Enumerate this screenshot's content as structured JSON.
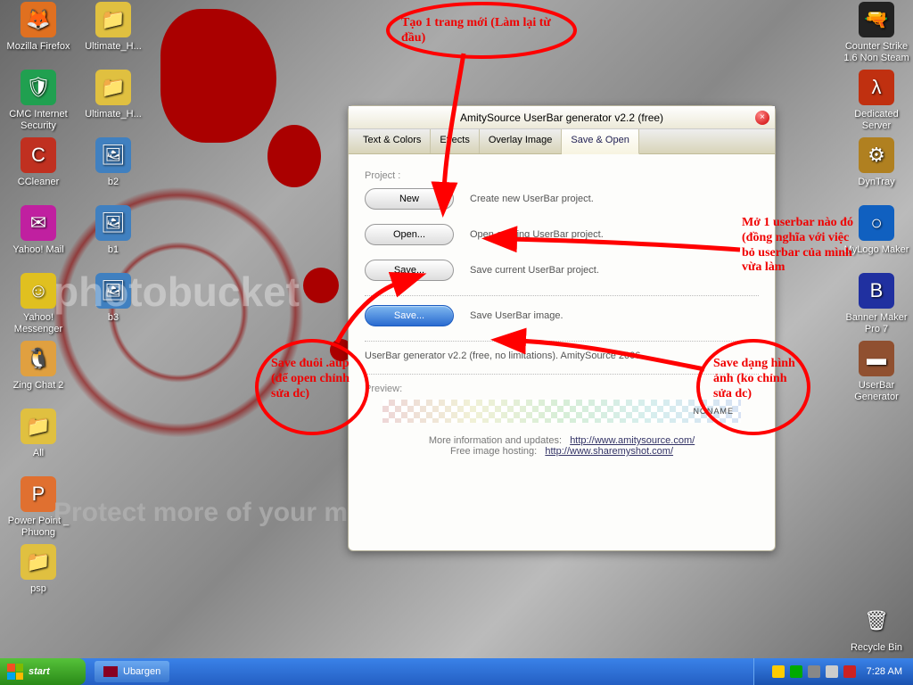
{
  "desktop": {
    "icons_left": [
      {
        "label": "Mozilla Firefox",
        "bg": "#e07020",
        "glyph": "🦊"
      },
      {
        "label": "CMC Internet Security",
        "bg": "#20a050",
        "glyph": "🛡"
      },
      {
        "label": "CCleaner",
        "bg": "#c03020",
        "glyph": "C"
      },
      {
        "label": "Yahoo! Mail",
        "bg": "#c020a0",
        "glyph": "✉"
      },
      {
        "label": "Yahoo! Messenger",
        "bg": "#e0c020",
        "glyph": "☺"
      },
      {
        "label": "Zing Chat 2",
        "bg": "#e0a040",
        "glyph": "🐧"
      },
      {
        "label": "All",
        "bg": "#e0c040",
        "glyph": "📁"
      },
      {
        "label": "Power Point _ Phuong",
        "bg": "#e07030",
        "glyph": "P"
      },
      {
        "label": "psp",
        "bg": "#e0c040",
        "glyph": "📁"
      }
    ],
    "icons_left2": [
      {
        "label": "Ultimate_H...",
        "bg": "#e0c040",
        "glyph": "📁"
      },
      {
        "label": "Ultimate_H...",
        "bg": "#e0c040",
        "glyph": "📁"
      },
      {
        "label": "b2",
        "bg": "#4080c0",
        "glyph": "🖼"
      },
      {
        "label": "b1",
        "bg": "#4080c0",
        "glyph": "🖼"
      },
      {
        "label": "b3",
        "bg": "#4080c0",
        "glyph": "🖼"
      }
    ],
    "icons_right": [
      {
        "label": "Counter Strike 1.6 Non Steam",
        "bg": "#222",
        "glyph": "🔫"
      },
      {
        "label": "Dedicated Server",
        "bg": "#c03010",
        "glyph": "λ"
      },
      {
        "label": "DynTray",
        "bg": "#b08020",
        "glyph": "⚙"
      },
      {
        "label": "MyLogo Maker",
        "bg": "#1060c0",
        "glyph": "○"
      },
      {
        "label": "Banner Maker Pro 7",
        "bg": "#2030a0",
        "glyph": "B"
      },
      {
        "label": "UserBar Generator",
        "bg": "#905030",
        "glyph": "▬"
      },
      {
        "label": "Recycle Bin",
        "bg": "transparent",
        "glyph": "🗑"
      }
    ]
  },
  "app": {
    "title": "AmitySource UserBar generator v2.2 (free)",
    "tabs": [
      "Text & Colors",
      "Effects",
      "Overlay Image",
      "Save & Open"
    ],
    "activeTab": 3,
    "project_label": "Project :",
    "btn_new": "New",
    "btn_new_desc": "Create new UserBar project.",
    "btn_open": "Open...",
    "btn_open_desc": "Open existing UserBar project.",
    "btn_save": "Save...",
    "btn_save_desc": "Save current UserBar project.",
    "btn_saveimg": "Save...",
    "btn_saveimg_desc": "Save UserBar image.",
    "about": "UserBar generator v2.2 (free, no limitations). AmitySource 2006",
    "preview_label": "Preview:",
    "preview_text": "NONAME",
    "footer_info": "More information and updates:",
    "footer_info_url": "http://www.amitysource.com/",
    "footer_host": "Free image hosting:",
    "footer_host_url": "http://www.sharemyshot.com/"
  },
  "annotations": {
    "a1": "Tạo 1 trang mới (Làm lại từ đầu)",
    "a2": "Mở 1 userbar nào đó (đồng nghĩa với việc bỏ userbar của mình vừa làm",
    "a3": "Save đuôi .aup (để open chỉnh sửa dc)",
    "a4": "Save dạng hình ảnh (ko chỉnh sửa dc)"
  },
  "watermark_top": "photobucket",
  "watermark_bottom": "Protect more of your memories for less!",
  "taskbar": {
    "start": "start",
    "task1": "Ubargen",
    "clock": "7:28 AM"
  }
}
